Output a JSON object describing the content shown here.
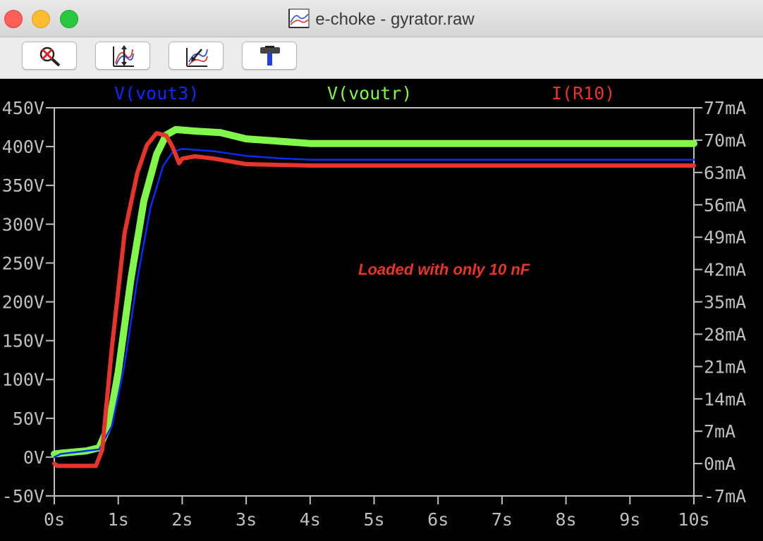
{
  "window": {
    "title": "e-choke - gyrator.raw"
  },
  "toolbar": {
    "buttons": [
      {
        "icon": "zoom-cancel-icon"
      },
      {
        "icon": "autorange-icon"
      },
      {
        "icon": "zoom-back-icon"
      },
      {
        "icon": "hammer-icon"
      }
    ]
  },
  "annotation": "Loaded with only 10 nF",
  "colors": {
    "vout3": "#0a2bff",
    "voutr": "#80f74a",
    "r10": "#e8352b",
    "axis": "#bfbfbf",
    "tick_text": "#bfbfbf"
  },
  "chart_data": {
    "type": "line",
    "x_ticks": [
      "0s",
      "1s",
      "2s",
      "3s",
      "4s",
      "5s",
      "6s",
      "7s",
      "8s",
      "9s",
      "10s"
    ],
    "y_left_ticks": [
      "450V",
      "400V",
      "350V",
      "300V",
      "250V",
      "200V",
      "150V",
      "100V",
      "50V",
      "0V",
      "-50V"
    ],
    "y_right_ticks": [
      "77mA",
      "70mA",
      "63mA",
      "56mA",
      "49mA",
      "42mA",
      "35mA",
      "28mA",
      "21mA",
      "14mA",
      "7mA",
      "0mA",
      "-7mA"
    ],
    "xlim": [
      0,
      10
    ],
    "ylim_left": [
      -50,
      450
    ],
    "ylim_right": [
      -7,
      77
    ],
    "series": [
      {
        "name": "V(vout3)",
        "axis": "left",
        "x": [
          0,
          0.1,
          0.5,
          0.7,
          0.9,
          1.1,
          1.3,
          1.5,
          1.7,
          1.85,
          2.0,
          2.5,
          3.0,
          3.5,
          4.0,
          5.0,
          7.0,
          10.0
        ],
        "y": [
          0,
          4,
          8,
          10,
          40,
          120,
          230,
          320,
          375,
          393,
          397,
          394,
          388,
          385,
          383,
          383,
          383,
          383
        ]
      },
      {
        "name": "V(voutr)",
        "axis": "left",
        "x": [
          0,
          0.1,
          0.5,
          0.7,
          0.85,
          1.0,
          1.2,
          1.4,
          1.6,
          1.75,
          1.9,
          2.2,
          2.6,
          3.0,
          3.5,
          4.0,
          5.0,
          7.0,
          10.0
        ],
        "y": [
          4,
          5,
          8,
          12,
          40,
          110,
          230,
          330,
          390,
          415,
          422,
          420,
          418,
          410,
          407,
          404,
          404,
          404,
          404
        ]
      },
      {
        "name": "I(R10)",
        "axis": "right",
        "x": [
          0,
          0.05,
          0.3,
          0.65,
          0.75,
          0.9,
          1.1,
          1.3,
          1.45,
          1.6,
          1.75,
          1.85,
          1.95,
          2.0,
          2.2,
          2.5,
          3.0,
          4.0,
          6.0,
          10.0
        ],
        "y": [
          0,
          -0.5,
          -0.5,
          -0.5,
          3,
          25,
          50,
          63,
          69,
          71.5,
          71,
          68.5,
          65,
          66,
          66.5,
          66,
          64.8,
          64.5,
          64.5,
          64.5
        ]
      }
    ]
  }
}
